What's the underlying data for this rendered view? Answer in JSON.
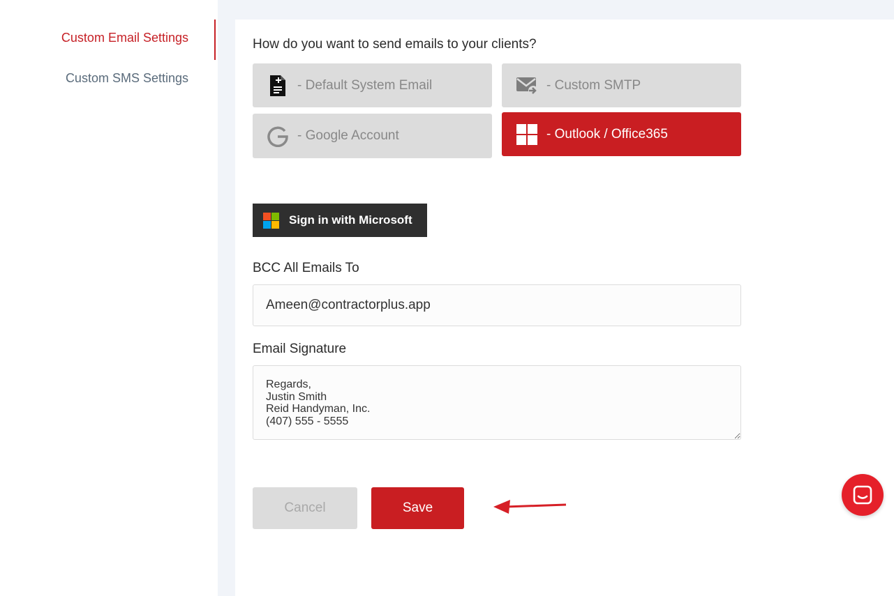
{
  "sidebar": {
    "items": [
      {
        "label": "Custom Email Settings",
        "active": true
      },
      {
        "label": "Custom SMS Settings",
        "active": false
      }
    ]
  },
  "main": {
    "question": "How do you want to send emails to your clients?",
    "options": [
      {
        "label": "- Default System Email",
        "icon": "document-icon",
        "selected": false
      },
      {
        "label": "- Custom SMTP",
        "icon": "mail-forward-icon",
        "selected": false
      },
      {
        "label": "- Google Account",
        "icon": "google-g-icon",
        "selected": false
      },
      {
        "label": "- Outlook / Office365",
        "icon": "windows-icon",
        "selected": true
      }
    ],
    "microsoft_button": "Sign in with Microsoft",
    "bcc_label": "BCC All Emails To",
    "bcc_value": "Ameen@contractorplus.app",
    "signature_label": "Email Signature",
    "signature_value": "Regards,\nJustin Smith\nReid Handyman, Inc.\n(407) 555 - 5555",
    "cancel_label": "Cancel",
    "save_label": "Save"
  },
  "colors": {
    "accent": "#c91e22",
    "sidebar_inactive": "#5a6b7b",
    "option_bg": "#dcdcdc",
    "chat": "#e5202a"
  }
}
